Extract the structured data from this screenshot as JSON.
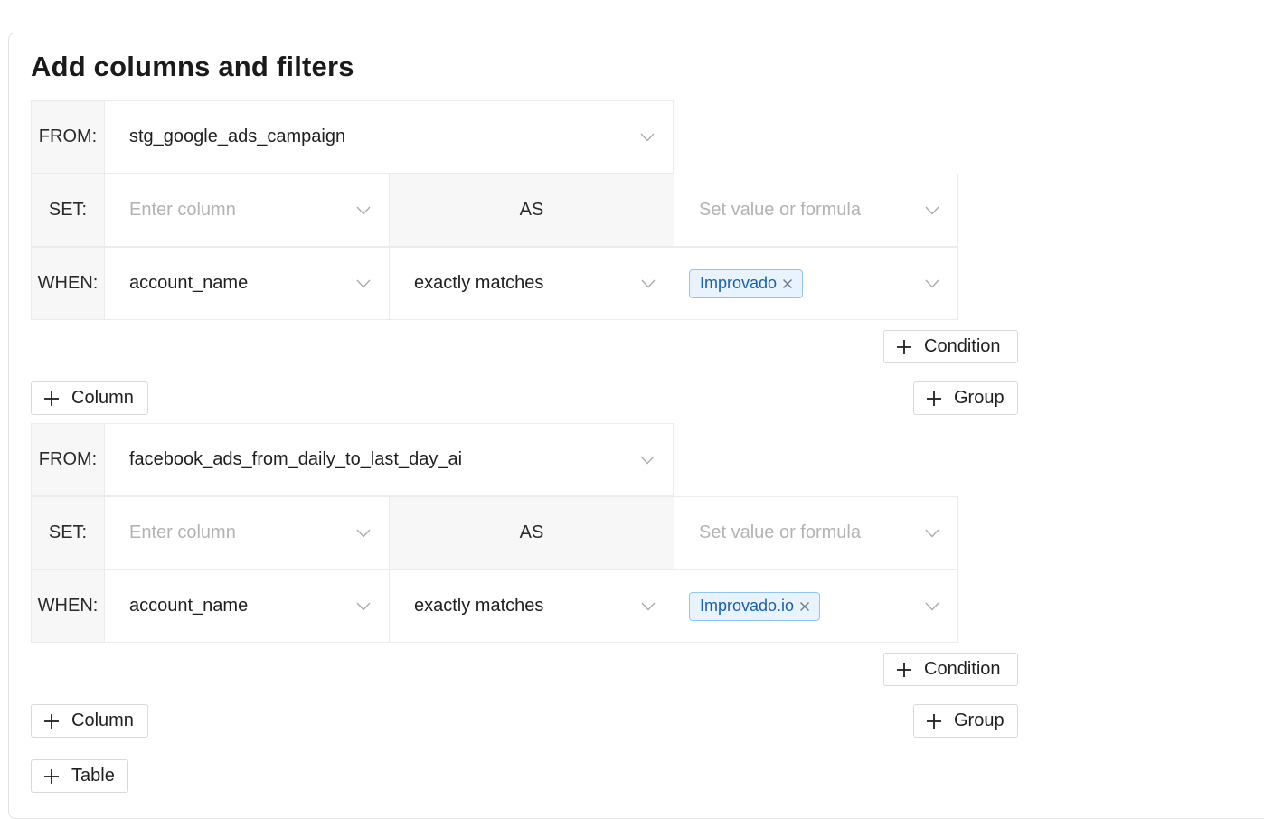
{
  "title": "Add columns and filters",
  "tables": [
    {
      "from_label": "FROM:",
      "from_value": "stg_google_ads_campaign",
      "set_label": "SET:",
      "set_column_placeholder": "Enter column",
      "as_label": "AS",
      "set_value_placeholder": "Set value or formula",
      "when_label": "WHEN:",
      "when_column": "account_name",
      "when_operator": "exactly matches",
      "when_tag": "Improvado",
      "condition_button": "Condition",
      "column_button": "Column",
      "group_button": "Group"
    },
    {
      "from_label": "FROM:",
      "from_value": "facebook_ads_from_daily_to_last_day_ai",
      "set_label": "SET:",
      "set_column_placeholder": "Enter column",
      "as_label": "AS",
      "set_value_placeholder": "Set value or formula",
      "when_label": "WHEN:",
      "when_column": "account_name",
      "when_operator": "exactly matches",
      "when_tag": "Improvado.io",
      "condition_button": "Condition",
      "column_button": "Column",
      "group_button": "Group"
    }
  ],
  "table_button": "Table",
  "icons": {
    "chevron": "chevron-down-icon",
    "plus": "plus-icon",
    "remove": "close-icon"
  }
}
